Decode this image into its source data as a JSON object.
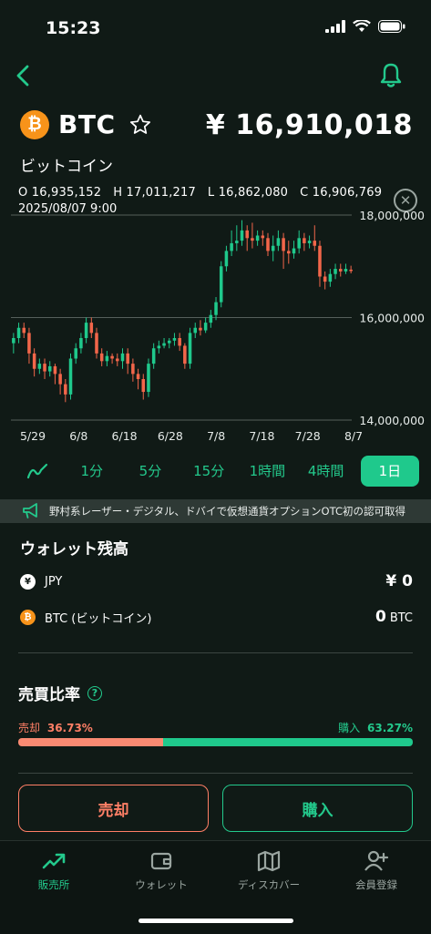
{
  "status": {
    "time": "15:23"
  },
  "coin": {
    "symbol": "BTC",
    "logo_glyph": "₿",
    "name_ja": "ビットコイン",
    "price": "¥ 16,910,018",
    "brand_color": "#f7931a"
  },
  "ohlc": {
    "line": "O 16,935,152   H 17,011,217   L 16,862,080   C 16,906,769",
    "date": "2025/08/07 9:00"
  },
  "chart_data": {
    "type": "candlestick",
    "y_ticks": [
      "18,000,000",
      "16,000,000",
      "14,000,000"
    ],
    "x_ticks": [
      "5/29",
      "6/8",
      "6/18",
      "6/28",
      "7/8",
      "7/18",
      "7/28",
      "8/7"
    ],
    "ylim": [
      14000000,
      18000000
    ],
    "up_color": "#1fc98c",
    "down_color": "#f2664a",
    "candles": [
      [
        15500000,
        15600000,
        15700000,
        15300000
      ],
      [
        15600000,
        15800000,
        15900000,
        15500000
      ],
      [
        15800000,
        15700000,
        15900000,
        15600000
      ],
      [
        15700000,
        15300000,
        15800000,
        15100000
      ],
      [
        15300000,
        15000000,
        15400000,
        14850000
      ],
      [
        15000000,
        15100000,
        15200000,
        14900000
      ],
      [
        15100000,
        14950000,
        15200000,
        14800000
      ],
      [
        14950000,
        15050000,
        15150000,
        14850000
      ],
      [
        15050000,
        14900000,
        15100000,
        14700000
      ],
      [
        14900000,
        14700000,
        15000000,
        14500000
      ],
      [
        14700000,
        14500000,
        14800000,
        14350000
      ],
      [
        14500000,
        15200000,
        15300000,
        14400000
      ],
      [
        15200000,
        15400000,
        15500000,
        15100000
      ],
      [
        15400000,
        15600000,
        15700000,
        15300000
      ],
      [
        15600000,
        15900000,
        16000000,
        15500000
      ],
      [
        15900000,
        15700000,
        16000000,
        15600000
      ],
      [
        15700000,
        15300000,
        15800000,
        15200000
      ],
      [
        15300000,
        15150000,
        15400000,
        15050000
      ],
      [
        15150000,
        15250000,
        15350000,
        15050000
      ],
      [
        15250000,
        15200000,
        15300000,
        15100000
      ],
      [
        15200000,
        15150000,
        15300000,
        15050000
      ],
      [
        15150000,
        15300000,
        15400000,
        15000000
      ],
      [
        15300000,
        15100000,
        15400000,
        14900000
      ],
      [
        15100000,
        14900000,
        15200000,
        14750000
      ],
      [
        14900000,
        14800000,
        15000000,
        14600000
      ],
      [
        14800000,
        14550000,
        14900000,
        14400000
      ],
      [
        14550000,
        15100000,
        15200000,
        14450000
      ],
      [
        15100000,
        15400000,
        15500000,
        15000000
      ],
      [
        15400000,
        15450000,
        15550000,
        15300000
      ],
      [
        15450000,
        15500000,
        15600000,
        15400000
      ],
      [
        15500000,
        15550000,
        15600000,
        15400000
      ],
      [
        15550000,
        15600000,
        15700000,
        15450000
      ],
      [
        15600000,
        15450000,
        15700000,
        15350000
      ],
      [
        15450000,
        15100000,
        15500000,
        15000000
      ],
      [
        15100000,
        15700000,
        15800000,
        15000000
      ],
      [
        15700000,
        15800000,
        15900000,
        15600000
      ],
      [
        15800000,
        15750000,
        15950000,
        15650000
      ],
      [
        15750000,
        15900000,
        16000000,
        15700000
      ],
      [
        15900000,
        16050000,
        16150000,
        15800000
      ],
      [
        16050000,
        16300000,
        16400000,
        15950000
      ],
      [
        16300000,
        17000000,
        17100000,
        16200000
      ],
      [
        17000000,
        17300000,
        17400000,
        16900000
      ],
      [
        17300000,
        17450000,
        17700000,
        17200000
      ],
      [
        17450000,
        17500000,
        17800000,
        17300000
      ],
      [
        17500000,
        17700000,
        17900000,
        17400000
      ],
      [
        17700000,
        17550000,
        17800000,
        17300000
      ],
      [
        17550000,
        17500000,
        17850000,
        17350000
      ],
      [
        17500000,
        17600000,
        17700000,
        17400000
      ],
      [
        17600000,
        17550000,
        17700000,
        17400000
      ],
      [
        17550000,
        17300000,
        17650000,
        17200000
      ],
      [
        17300000,
        17400000,
        17600000,
        17100000
      ],
      [
        17400000,
        17550000,
        17700000,
        17300000
      ],
      [
        17550000,
        17300000,
        17650000,
        16950000
      ],
      [
        17300000,
        17250000,
        17500000,
        17050000
      ],
      [
        17250000,
        17350000,
        17500000,
        17150000
      ],
      [
        17350000,
        17550000,
        17700000,
        17250000
      ],
      [
        17550000,
        17450000,
        17650000,
        17300000
      ],
      [
        17450000,
        17500000,
        17600000,
        17350000
      ],
      [
        17500000,
        17400000,
        17800000,
        17300000
      ],
      [
        17400000,
        16800000,
        17500000,
        16600000
      ],
      [
        16800000,
        16700000,
        16900000,
        16550000
      ],
      [
        16700000,
        16850000,
        16950000,
        16600000
      ],
      [
        16850000,
        16950000,
        17050000,
        16750000
      ],
      [
        16950000,
        16900000,
        17050000,
        16800000
      ],
      [
        16900000,
        16950000,
        17050000,
        16850000
      ],
      [
        16935152,
        16906769,
        17011217,
        16862080
      ]
    ]
  },
  "timeframes": {
    "line_icon": "line-chart-icon",
    "items": [
      "1分",
      "5分",
      "15分",
      "1時間",
      "4時間",
      "1日"
    ],
    "active": "1日"
  },
  "news": {
    "text": "野村系レーザー・デジタル、ドバイで仮想通貨オプションOTC初の認可取得"
  },
  "wallet": {
    "title": "ウォレット残高",
    "jpy": {
      "glyph": "¥",
      "label": "JPY",
      "amount": "¥ 0"
    },
    "btc": {
      "glyph": "₿",
      "label": "BTC (ビットコイン)",
      "amount": "0",
      "unit": "BTC"
    }
  },
  "ratio": {
    "title": "売買比率",
    "sell_label": "売却",
    "sell_value": "36.73%",
    "sell_fraction": 0.3673,
    "buy_label": "購入",
    "buy_value": "63.27%",
    "buy_fraction": 0.6327
  },
  "actions": {
    "sell": "売却",
    "buy": "購入"
  },
  "nav": {
    "items": [
      {
        "label": "販売所",
        "icon": "trend-up-icon",
        "active": true
      },
      {
        "label": "ウォレット",
        "icon": "wallet-icon",
        "active": false
      },
      {
        "label": "ディスカバー",
        "icon": "map-icon",
        "active": false
      },
      {
        "label": "会員登録",
        "icon": "add-user-icon",
        "active": false
      }
    ]
  },
  "colors": {
    "accent": "#1fc98c",
    "sell": "#ff7f66",
    "background": "#101a16"
  }
}
